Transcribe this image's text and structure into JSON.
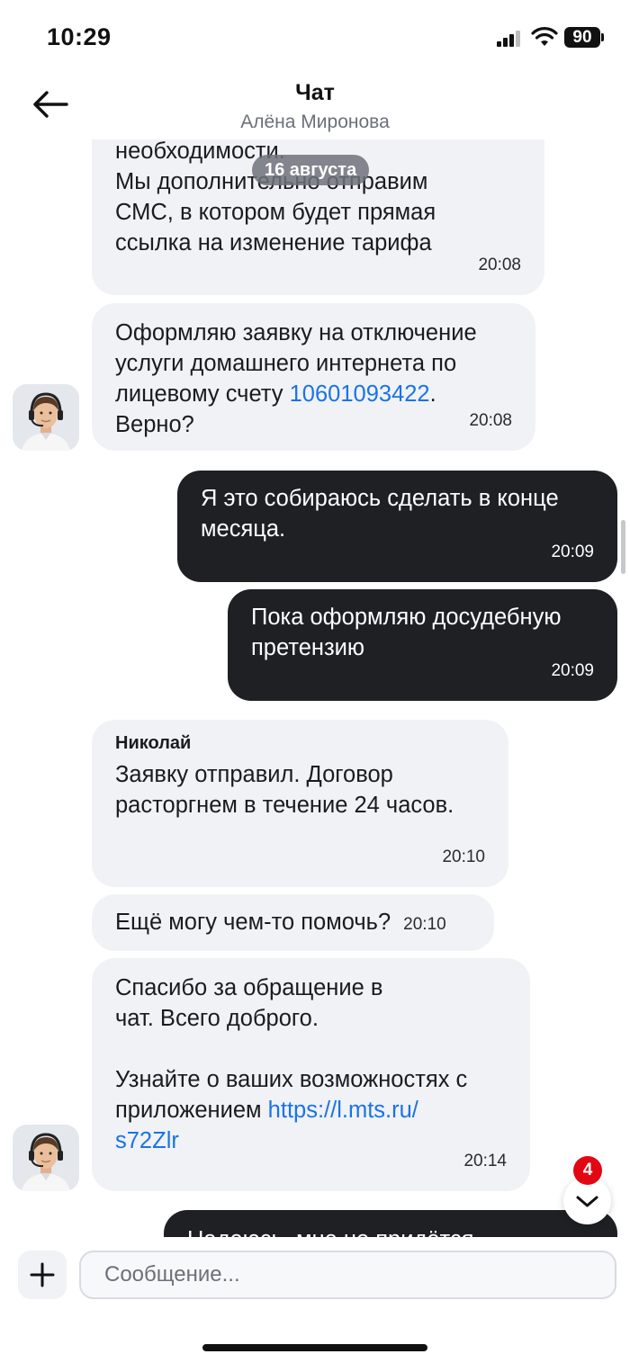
{
  "status_bar": {
    "time": "10:29",
    "battery": "90"
  },
  "header": {
    "title": "Чат",
    "subtitle": "Алёна Миронова",
    "back_icon": "arrow-left-icon"
  },
  "date_chip": "16 августа",
  "messages": {
    "m0": {
      "text": "необходимости.\nМы дополнительно отправим\nСМС, в котором будет прямая\nссылка на изменение тарифа",
      "time": "20:08"
    },
    "m1": {
      "text_before": "Оформляю заявку на отключение\nуслуги домашнего интернета по\nлицевому счету ",
      "link": "10601093422",
      "text_after": ".\nВерно?",
      "time": "20:08"
    },
    "m2": {
      "text": "Я это собираюсь сделать в конце\nмесяца.",
      "time": "20:09"
    },
    "m3": {
      "text": "Пока оформляю досудебную\nпретензию",
      "time": "20:09"
    },
    "m4": {
      "sender": "Николай",
      "text": "Заявку отправил. Договор\nрасторгнем в течение 24 часов.",
      "time": "20:10"
    },
    "m5": {
      "text": "Ещё могу чем-то помочь?",
      "time": "20:10"
    },
    "m6": {
      "text_before": "Спасибо за обращение в\nчат. Всего доброго.\n\nУзнайте о ваших возможностях с\nприложением ",
      "link": "https://l.mts.ru/\ns72Zlr",
      "time": "20:14"
    },
    "m7": {
      "text": "Надеюсь, мне не придётся"
    }
  },
  "scroll_down": {
    "badge": "4",
    "icon": "chevron-down-icon"
  },
  "composer": {
    "placeholder": "Сообщение...",
    "add_icon": "plus-icon"
  },
  "colors": {
    "incoming": "#f1f2f6",
    "outgoing": "#1e2024",
    "link": "#1a73e8",
    "badge": "#e30613"
  }
}
